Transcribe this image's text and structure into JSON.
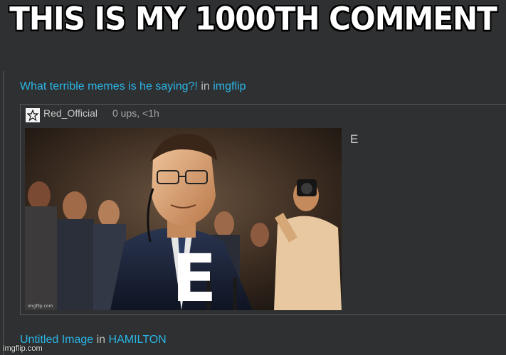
{
  "caption": "THIS IS MY 1000TH COMMENT",
  "comment": {
    "title_link": "What terrible memes is he saying?!",
    "in_word": "in",
    "stream_link": "imgflip"
  },
  "reply": {
    "username": "Red_Official",
    "meta": "0 ups, <1h",
    "image_letter": "E",
    "image_watermark": "imgflip.com",
    "side_text": "E"
  },
  "footer": {
    "title_link": "Untitled Image",
    "in_word": "in",
    "stream_link": "HAMILTON"
  },
  "watermark": "imgflip.com",
  "icons": {
    "user_icon": "star-icon"
  },
  "colors": {
    "background": "#2f3031",
    "link": "#2bb5e6",
    "text": "#bdbdbd"
  }
}
